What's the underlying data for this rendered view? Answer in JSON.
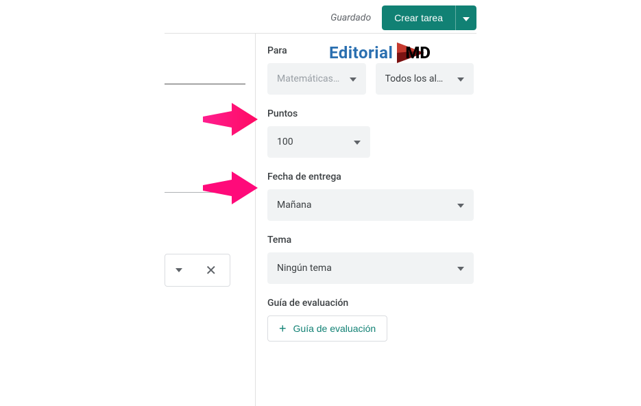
{
  "header": {
    "saved_label": "Guardado",
    "create_button": "Crear tarea"
  },
  "sidebar": {
    "para": {
      "label": "Para",
      "class_selected": "Matemáticas…",
      "students_selected": "Todos los al…"
    },
    "puntos": {
      "label": "Puntos",
      "value": "100"
    },
    "fecha": {
      "label": "Fecha de entrega",
      "value": "Mañana"
    },
    "tema": {
      "label": "Tema",
      "value": "Ningún tema"
    },
    "rubric": {
      "label": "Guía de evaluación",
      "button": "Guía de evaluación"
    }
  },
  "watermark": {
    "text1": "Editorial",
    "text2": "MD"
  }
}
